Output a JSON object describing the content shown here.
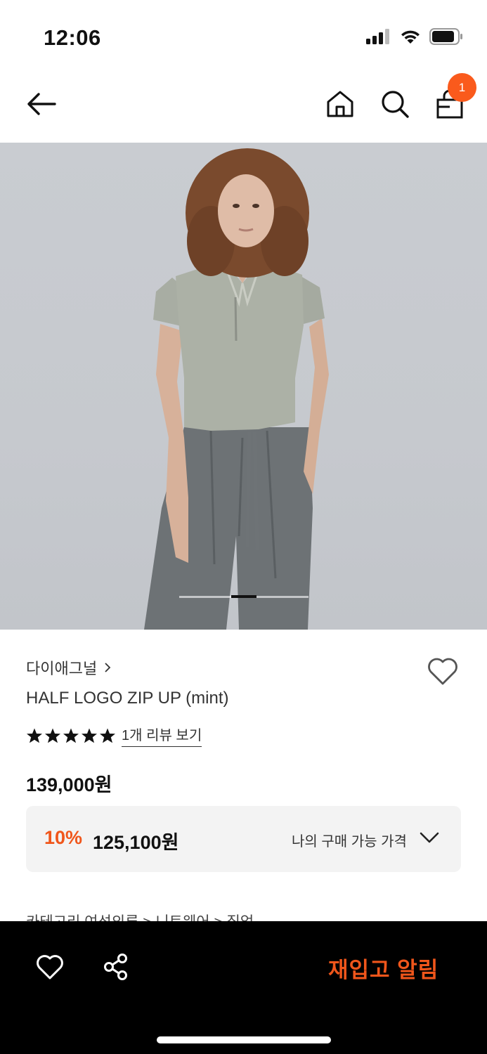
{
  "status_bar": {
    "time": "12:06"
  },
  "header": {
    "cart_count": "1"
  },
  "product": {
    "brand": "다이애그널",
    "name": "HALF LOGO ZIP UP (mint)",
    "rating_stars": 5,
    "review_link": "1개 리뷰 보기",
    "price": "139,000원",
    "discount_percent": "10%",
    "discount_price": "125,100원",
    "my_price_label": "나의 구매 가능 가격",
    "category_partial": "카테고리         여성의류 > 니트웨어 > 집업"
  },
  "gallery": {
    "current_index": 3,
    "total": 5
  },
  "bottom_bar": {
    "restock_label": "재입고 알림"
  },
  "colors": {
    "accent": "#f0561b",
    "badge": "#fa5a1c",
    "bar_bg": "#000000"
  }
}
